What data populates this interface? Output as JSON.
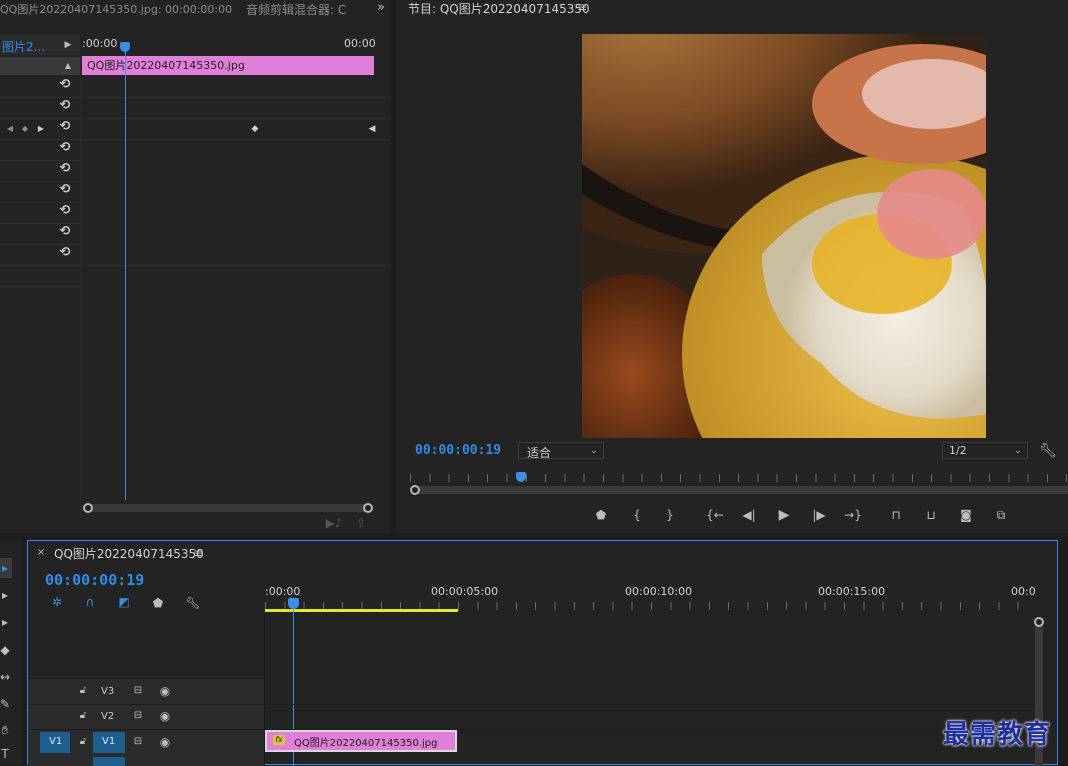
{
  "source_panel": {
    "tab_title": "QQ图片20220407145350.jpg: 00:00:00:00",
    "mixer_tab": "音频剪辑混合器: C",
    "overflow_icon": "double-chevron-right-icon",
    "clip_name_short": "图片2...",
    "time_start": ":00:00",
    "time_end": "00:00",
    "clip_label": "QQ图片20220407145350.jpg"
  },
  "program_monitor": {
    "title": "节目: QQ图片20220407145350",
    "timecode": "00:00:00:19",
    "fit_label": "适合",
    "resolution_label": "1/2"
  },
  "timeline": {
    "sequence_name": "QQ图片20220407145350",
    "timecode": "00:00:00:19",
    "ruler_labels": [
      ":00:00",
      "00:00:05:00",
      "00:00:10:00",
      "00:00:15:00",
      "00:0"
    ],
    "tracks": [
      {
        "name": "V3",
        "source": ""
      },
      {
        "name": "V2",
        "source": ""
      },
      {
        "name": "V1",
        "source": "V1"
      }
    ],
    "clip_label": "QQ图片20220407145350.jpg",
    "fx_badge": "fx"
  },
  "watermark": "最需教育",
  "colors": {
    "accent_blue": "#2d8ceb",
    "clip_pink": "#e07fd9",
    "panel_bg": "#232323",
    "work_area_yellow": "#e6e62e"
  }
}
